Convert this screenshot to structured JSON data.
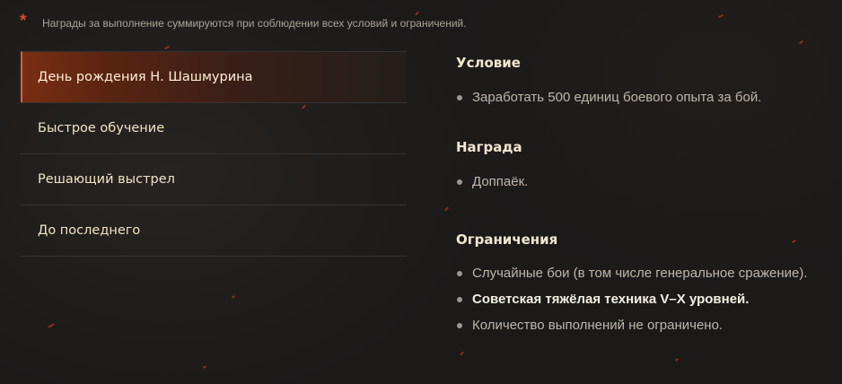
{
  "notice": {
    "marker": "*",
    "text": "Награды за выполнение суммируются при соблюдении всех условий и ограничений."
  },
  "tabs": [
    {
      "label": "День рождения Н. Шашмурина",
      "active": true
    },
    {
      "label": "Быстрое обучение",
      "active": false
    },
    {
      "label": "Решающий выстрел",
      "active": false
    },
    {
      "label": "До последнего",
      "active": false
    }
  ],
  "condition": {
    "title": "Условие",
    "items": [
      "Заработать 500 единиц боевого опыта за бой."
    ]
  },
  "reward": {
    "title": "Награда",
    "items": [
      "Доппаёк."
    ]
  },
  "restrictions": {
    "title": "Ограничения",
    "items": [
      "Случайные бои (в том числе генеральное сражение).",
      "Советская тяжёлая техника V–X уровней.",
      "Количество выполнений не ограничено."
    ]
  },
  "colors": {
    "accent": "#e0462b",
    "active_tab_gradient_start": "#7a2e12",
    "background": "#1d1c1b",
    "title_text": "#f2e6cf"
  }
}
